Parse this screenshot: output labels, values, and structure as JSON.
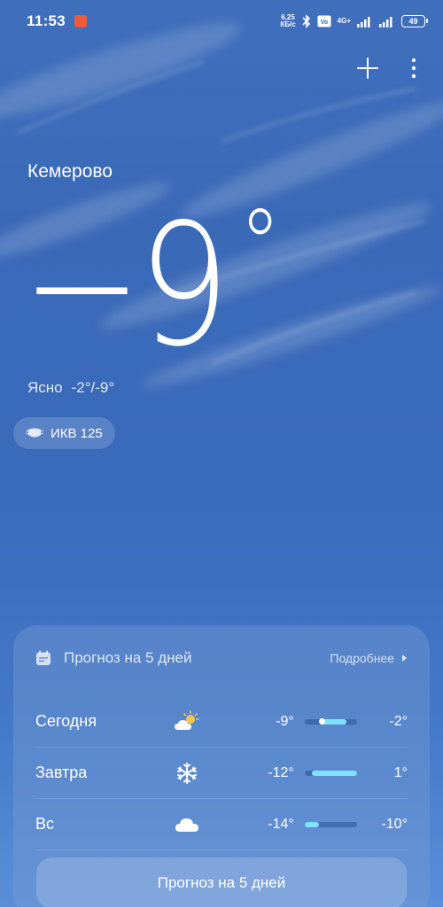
{
  "status_bar": {
    "time": "11:53",
    "net_speed_value": "6,25",
    "net_speed_unit": "КБ/с",
    "network": "4G+",
    "battery": "49"
  },
  "weather": {
    "city": "Кемерово",
    "temperature": "−9",
    "degree_symbol": "°",
    "condition": "Ясно",
    "range": "-2°/-9°",
    "aqi_label": "ИКВ 125"
  },
  "forecast": {
    "title": "Прогноз на 5 дней",
    "more_label": "Подробнее",
    "days": [
      {
        "name": "Сегодня",
        "icon": "partly-sunny-icon",
        "low": "-9°",
        "high": "-2°",
        "low_value": -9,
        "high_value": -2,
        "current_value": -9
      },
      {
        "name": "Завтра",
        "icon": "snowflake-icon",
        "low": "-12°",
        "high": "1°",
        "low_value": -12,
        "high_value": 1
      },
      {
        "name": "Вс",
        "icon": "cloud-icon",
        "low": "-14°",
        "high": "-10°",
        "low_value": -14,
        "high_value": -10
      }
    ],
    "button_label": "Прогноз на 5 дней",
    "scale_min": -14,
    "scale_max": 1
  },
  "colors": {
    "bar_fill": "#7fe3ff",
    "sun": "#f6c744"
  }
}
